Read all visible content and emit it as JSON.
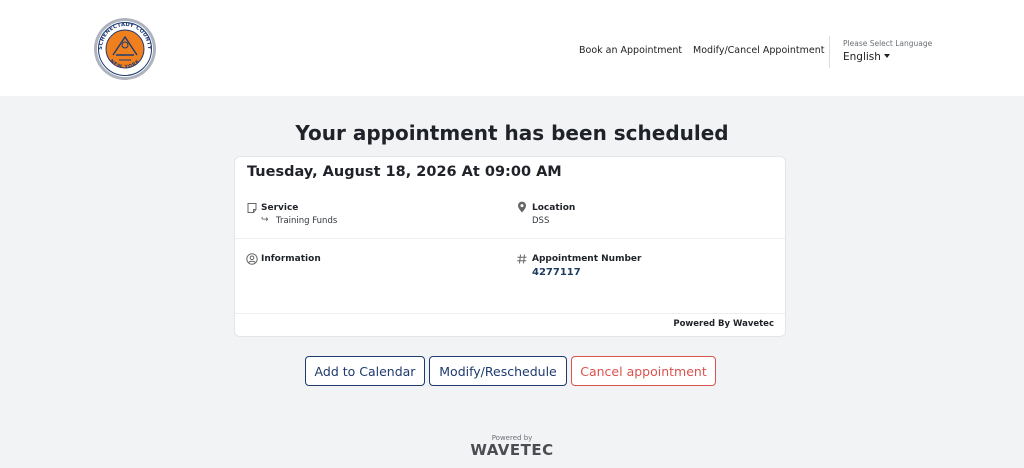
{
  "header": {
    "logo": {
      "name": "county-seal",
      "top_text": "SCHENECTADY COUNTY",
      "bottom_text": "NEW YORK",
      "colors": {
        "ring": "#9aa1ab",
        "fill": "#f07f1e",
        "inner": "#ffffff"
      }
    },
    "nav": {
      "book_label": "Book an Appointment",
      "modify_label": "Modify/Cancel Appointment"
    },
    "language": {
      "caption": "Please Select Language",
      "selected": "English"
    }
  },
  "main": {
    "title": "Your appointment has been scheduled",
    "card": {
      "datetime": "Tuesday, August 18, 2026 At 09:00 AM",
      "service": {
        "icon": "note-icon",
        "label": "Service",
        "value": "Training Funds"
      },
      "location": {
        "icon": "map-pin-icon",
        "label": "Location",
        "value": "DSS"
      },
      "information": {
        "icon": "user-circle-icon",
        "label": "Information"
      },
      "appointment_number": {
        "icon": "hash-icon",
        "label": "Appointment Number",
        "value": "4277117"
      },
      "powered_by": "Powered By Wavetec"
    },
    "actions": {
      "add_calendar": "Add to Calendar",
      "modify": "Modify/Reschedule",
      "cancel": "Cancel appointment"
    },
    "colors": {
      "primary": "#1e3a6e",
      "danger": "#d9534f"
    }
  },
  "footer": {
    "caption": "Powered by",
    "brand": "WAVETEC"
  }
}
